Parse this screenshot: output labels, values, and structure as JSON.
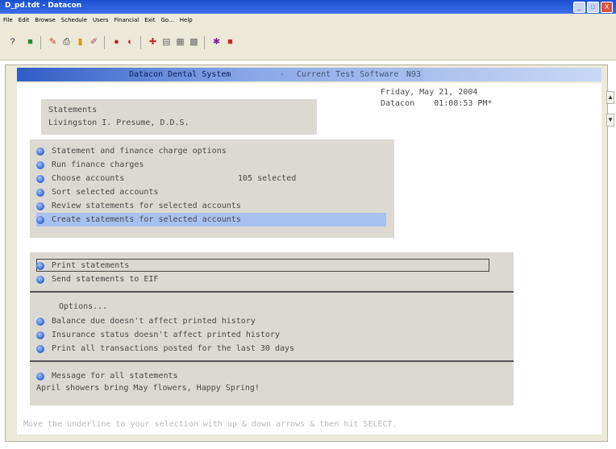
{
  "window": {
    "title": "D_pd.tdt - Datacon",
    "buttons": [
      "_",
      "□",
      "X"
    ]
  },
  "menubar": [
    "File",
    "Edit",
    "Browse",
    "Schedule",
    "Users",
    "Financial",
    "Exit",
    "Go...",
    "Help"
  ],
  "toolbar": {
    "icons": [
      {
        "name": "help-icon",
        "glyph": "?",
        "color": "#334"
      },
      {
        "name": "green-square-icon",
        "glyph": "■",
        "color": "#1f8f2b"
      },
      {
        "name": "patient-icon",
        "glyph": "✎",
        "color": "#c13b2b"
      },
      {
        "name": "printer-icon",
        "glyph": "⎙",
        "color": "#333"
      },
      {
        "name": "tooth-icon",
        "glyph": "▮",
        "color": "#d39c1f"
      },
      {
        "name": "pen-icon",
        "glyph": "✐",
        "color": "#b13d6a"
      },
      {
        "name": "drill-icon",
        "glyph": "●",
        "color": "#b6212a"
      },
      {
        "name": "moon-icon",
        "glyph": "◐",
        "color": "#b6212a"
      },
      {
        "name": "pin-icon",
        "glyph": "✚",
        "color": "#c8282c"
      },
      {
        "name": "document-icon",
        "glyph": "▤",
        "color": "#6b6b6b"
      },
      {
        "name": "grid-icon",
        "glyph": "▦",
        "color": "#6b6b6b"
      },
      {
        "name": "table-icon",
        "glyph": "▩",
        "color": "#6b6b6b"
      },
      {
        "name": "purple-icon",
        "glyph": "✱",
        "color": "#8c1aa5"
      },
      {
        "name": "red-flag-icon",
        "glyph": "■",
        "color": "#c8282c"
      }
    ]
  },
  "header": {
    "system": "Datacon Dental System",
    "separator": "-",
    "current": "Current Test Software",
    "software": "N93"
  },
  "statements_box": {
    "title": "Statements",
    "doctor": "Livingston I. Presume, D.D.S."
  },
  "datetime": {
    "date": "Friday, May 21, 2004",
    "source": "Datacon",
    "time": "01:08:53 PM*"
  },
  "menu_items": [
    {
      "label": "Statement and finance charge options"
    },
    {
      "label": "Run finance charges"
    },
    {
      "label": "Choose accounts",
      "extra": "105 selected"
    },
    {
      "label": "Sort selected accounts"
    },
    {
      "label": "Review statements for selected accounts"
    },
    {
      "label": "Create statements for selected accounts"
    }
  ],
  "print_section": {
    "items": [
      "Print statements",
      "Send statements to EIF"
    ],
    "options_label": "Options...",
    "options": [
      "Balance due doesn't affect printed history",
      "Insurance status doesn't affect printed history",
      "Print all transactions posted for the last 30 days"
    ],
    "message_label": "Message for all statements",
    "message": "April showers bring May flowers, Happy Spring!"
  },
  "hint": "Move the underline to your selection with up & down arrows & then hit SELECT."
}
